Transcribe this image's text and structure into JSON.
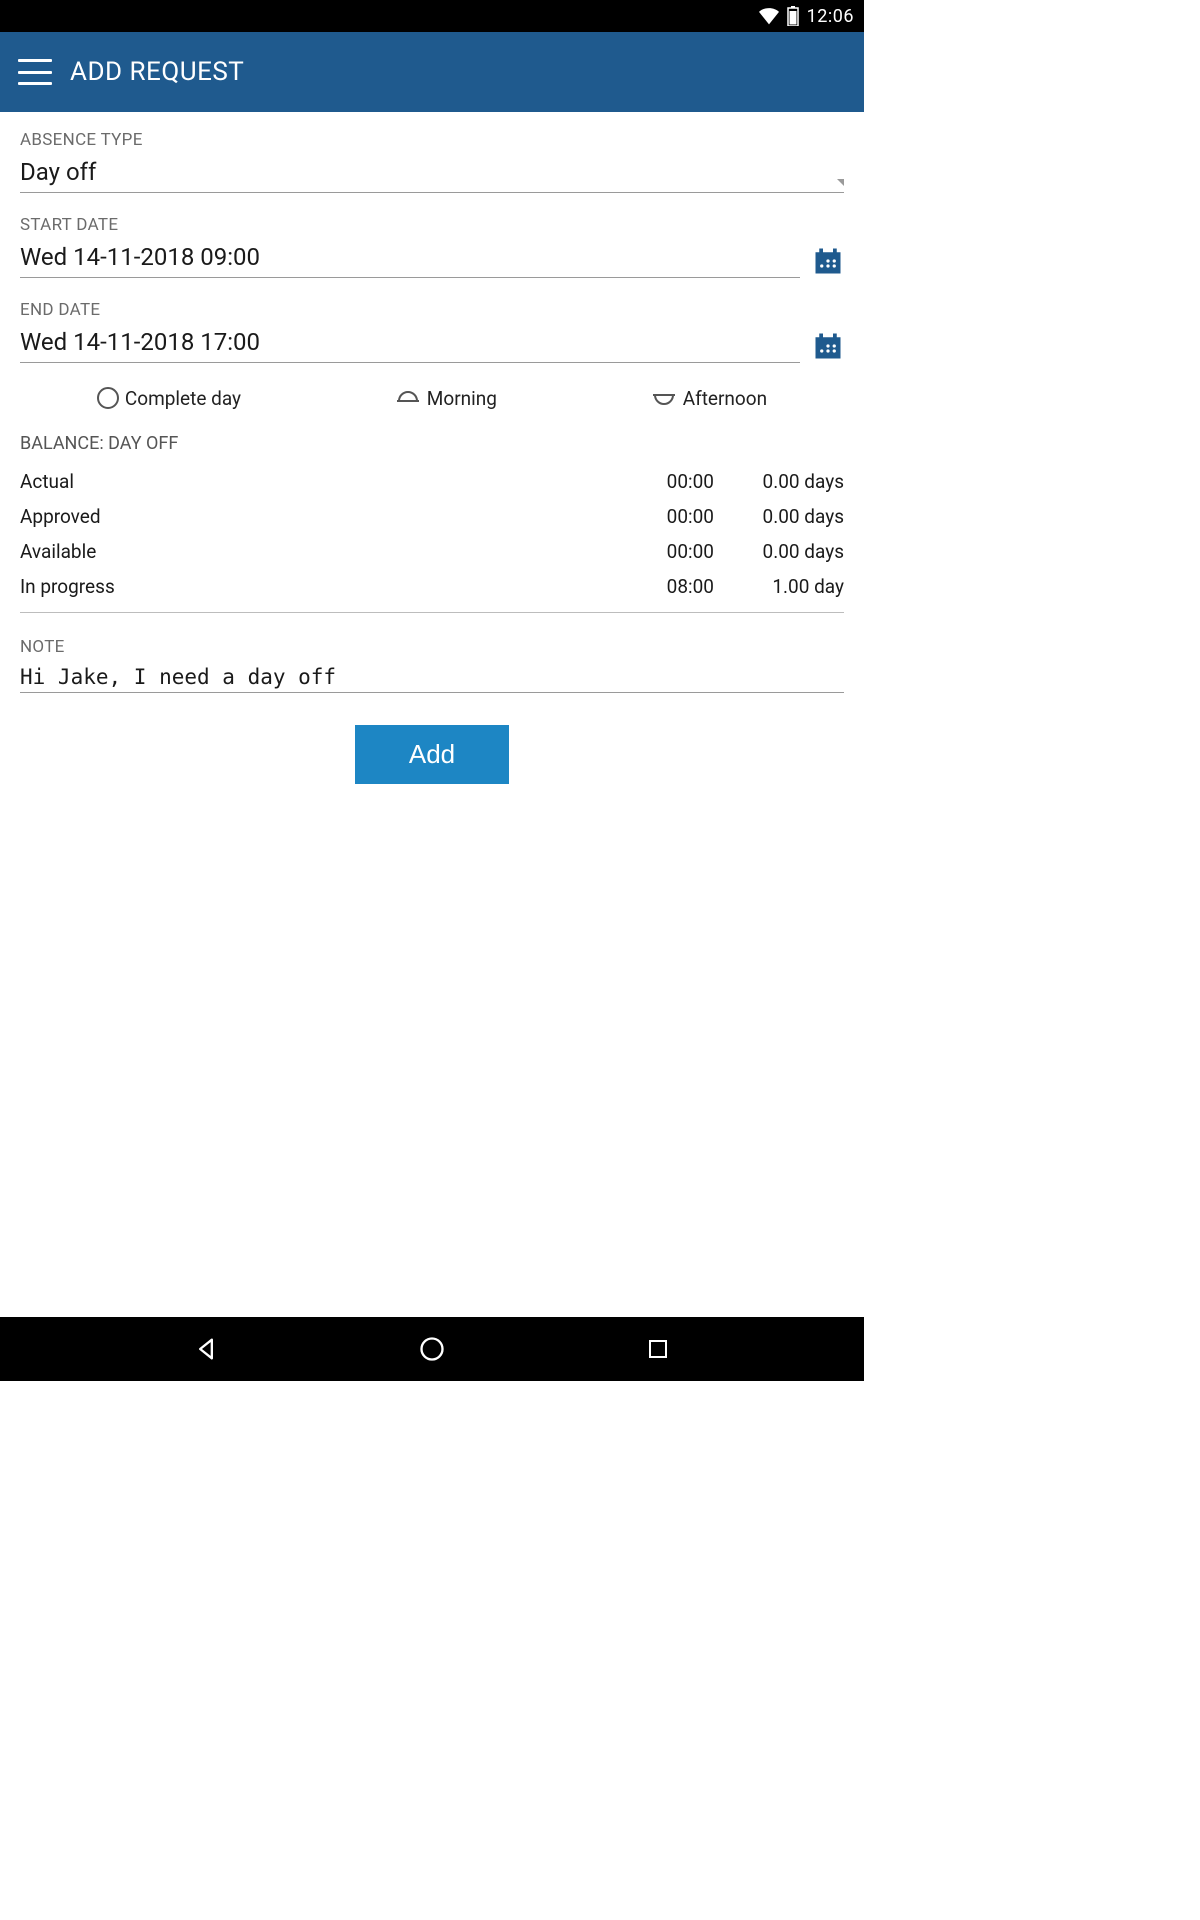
{
  "status": {
    "time": "12:06"
  },
  "header": {
    "title": "ADD REQUEST"
  },
  "form": {
    "absence_type_label": "ABSENCE TYPE",
    "absence_type_value": "Day off",
    "start_date_label": "START DATE",
    "start_date_value": "Wed 14-11-2018 09:00",
    "end_date_label": "END DATE",
    "end_date_value": "Wed 14-11-2018 17:00",
    "dayparts": {
      "complete": "Complete day",
      "morning": "Morning",
      "afternoon": "Afternoon"
    }
  },
  "balance": {
    "title": "BALANCE: DAY OFF",
    "rows": [
      {
        "label": "Actual",
        "hours": "00:00",
        "days": "0.00 days"
      },
      {
        "label": "Approved",
        "hours": "00:00",
        "days": "0.00 days"
      },
      {
        "label": "Available",
        "hours": "00:00",
        "days": "0.00 days"
      },
      {
        "label": "In progress",
        "hours": "08:00",
        "days": "1.00 day"
      }
    ]
  },
  "note": {
    "label": "NOTE",
    "value": "Hi Jake, I need a day off"
  },
  "actions": {
    "add": "Add"
  },
  "colors": {
    "primary": "#1f5a8e",
    "accent": "#1d86c4"
  }
}
